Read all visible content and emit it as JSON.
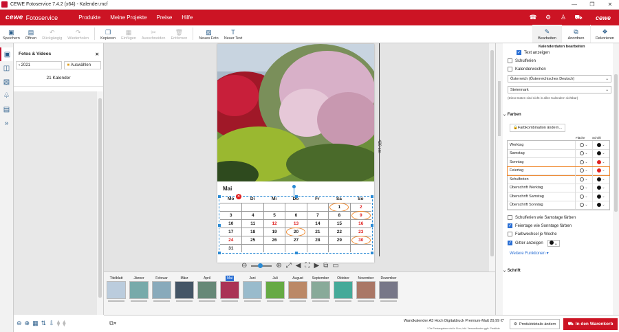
{
  "window": {
    "title": "CEWE Fotoservice 7.4.2 (x64) - Kalender.mcf"
  },
  "menu": {
    "logo": "cewe",
    "app": "Fotoservice",
    "items": [
      "Produkte",
      "Meine Projekte",
      "Preise",
      "Hilfe"
    ],
    "brand": "cewe"
  },
  "toolbar": {
    "items": [
      {
        "label": "Speichern",
        "icon": "save-icon",
        "enabled": true
      },
      {
        "label": "Öffnen",
        "icon": "folder-icon",
        "enabled": true
      },
      {
        "label": "Rückgängig",
        "icon": "undo-icon",
        "enabled": false
      },
      {
        "label": "Wiederholen",
        "icon": "redo-icon",
        "enabled": false
      },
      {
        "label": "Kopieren",
        "icon": "copy-icon",
        "enabled": true
      },
      {
        "label": "Einfügen",
        "icon": "paste-icon",
        "enabled": false
      },
      {
        "label": "Ausschneiden",
        "icon": "cut-icon",
        "enabled": false
      },
      {
        "label": "Entfernen",
        "icon": "trash-icon",
        "enabled": false
      },
      {
        "label": "Neues Foto",
        "icon": "photo-icon",
        "enabled": true
      },
      {
        "label": "Neuer Text",
        "icon": "text-icon",
        "enabled": true
      }
    ],
    "right_tabs": [
      "Bearbeiten",
      "Anordnen",
      "Dekorieren"
    ]
  },
  "photos": {
    "title": "Fotos & Videos",
    "year": "2021",
    "select": "Auswählen",
    "count": "21 Kalender"
  },
  "calendar": {
    "month": "Mai",
    "weekdays": [
      "Mo",
      "Di",
      "Mi",
      "Do",
      "Fr",
      "Sa",
      "So"
    ],
    "weeks": [
      [
        "",
        "",
        "",
        "",
        "",
        "1",
        "2"
      ],
      [
        "3",
        "4",
        "5",
        "6",
        "7",
        "8",
        "9"
      ],
      [
        "10",
        "11",
        "12",
        "13",
        "14",
        "15",
        "16"
      ],
      [
        "17",
        "18",
        "19",
        "20",
        "21",
        "22",
        "23"
      ],
      [
        "24",
        "25",
        "26",
        "27",
        "28",
        "29",
        "30"
      ],
      [
        "31",
        "",
        "",
        "",
        "",
        "",
        ""
      ]
    ],
    "dimension": "420 cm"
  },
  "thumbs": [
    "Titelblatt",
    "Jänner",
    "Februar",
    "März",
    "April",
    "Mai",
    "Juni",
    "Juli",
    "August",
    "September",
    "Oktober",
    "November",
    "Dezember"
  ],
  "active_thumb": "Mai",
  "right": {
    "section_title": "Kalenderdaten bearbeiten",
    "show_text": "Text anzeigen",
    "schulferien": "Schulferien",
    "kalenderwochen": "Kalenderwochen",
    "country": "Österreich (Österreichisches Deutsch)",
    "region": "Steiermark",
    "note": "(Diese Daten sind nicht in allen Kalendern sichtbar)",
    "farben": "Farben",
    "combo_btn": "Farbkombination ändern...",
    "col_flaeche": "Fläche",
    "col_schrift": "Schrift",
    "rows": [
      {
        "name": "Werktag",
        "font": "b"
      },
      {
        "name": "Samstag",
        "font": "b"
      },
      {
        "name": "Sonntag",
        "font": "r"
      },
      {
        "name": "Feiertag",
        "font": "r"
      },
      {
        "name": "Schulferien",
        "font": "b"
      },
      {
        "name": "Überschrift Werktag",
        "font": "b"
      },
      {
        "name": "Überschrift Samstag",
        "font": "b"
      },
      {
        "name": "Überschrift Sonntag",
        "font": "b"
      }
    ],
    "opt1": "Schulferien wie Samstage färben",
    "opt2": "Feiertage wie Sonntage färben",
    "opt3": "Farbwechsel je Woche",
    "opt4": "Gitter anzeigen",
    "more": "Weitere Funktionen",
    "schrift": "Schrift"
  },
  "footer": {
    "product": "Wandkalender A3 Hoch Digitaldruck Premium-Matt 29,99 €*",
    "product_sub": "* Die Preisangaben sind in Euro, inkl. Versandkosten ggfs. Preisliste",
    "details": "Produktdetails ändern",
    "cart": "In den Warenkorb"
  },
  "colors": {
    "accent": "#cc1424",
    "selection": "#2a6fd4",
    "highlight": "#f08a30"
  }
}
